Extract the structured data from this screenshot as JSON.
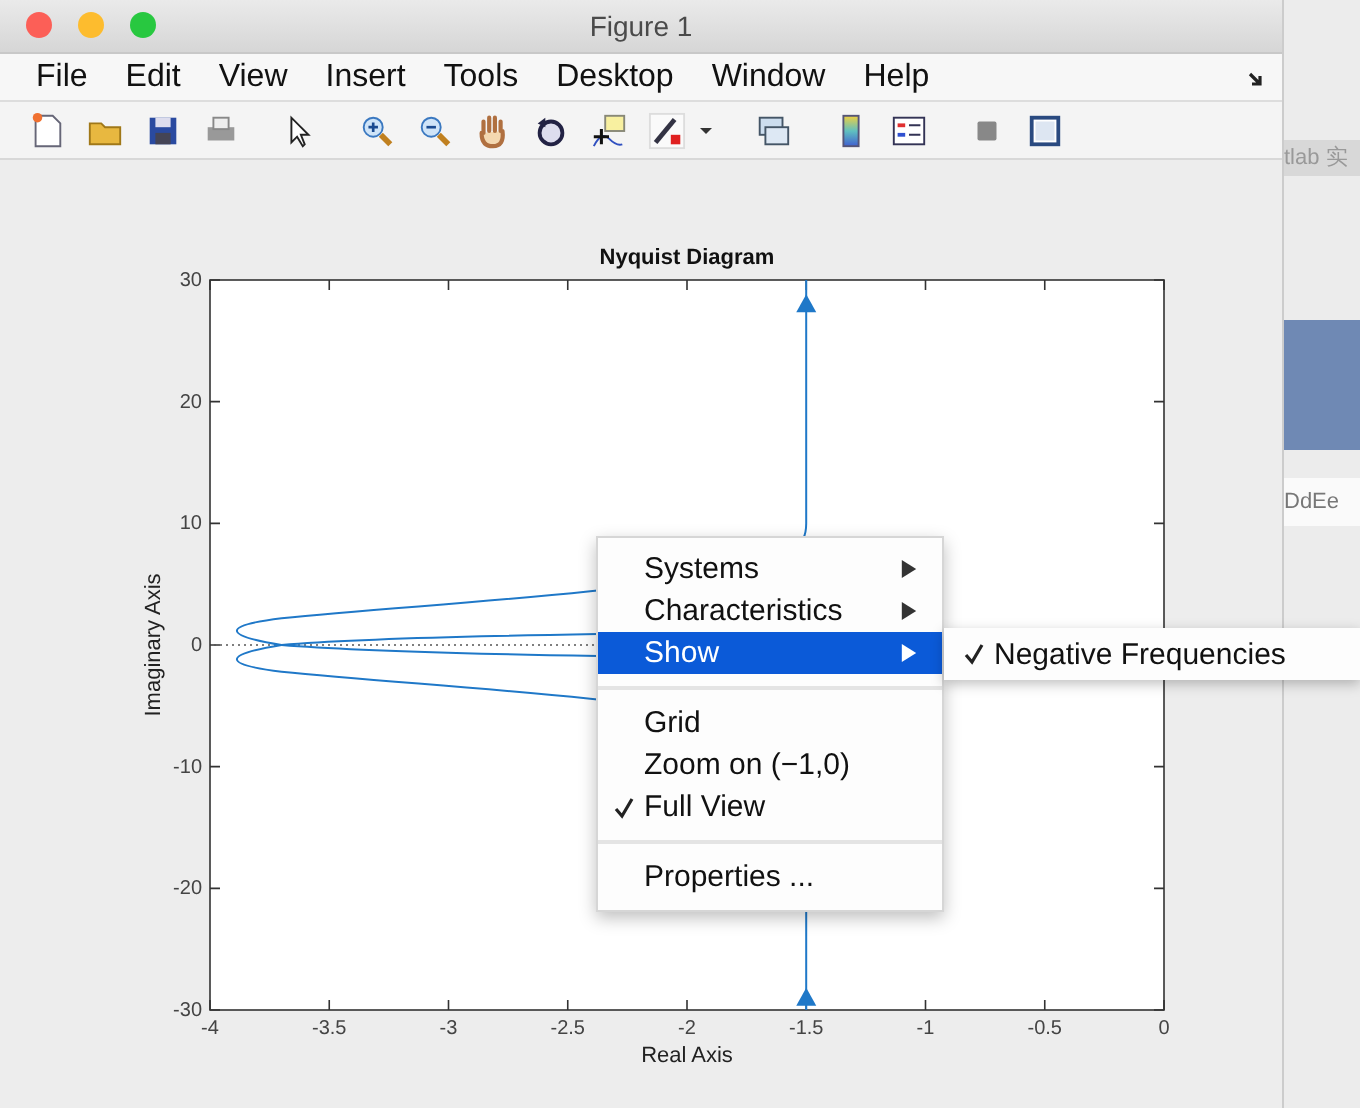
{
  "window": {
    "title": "Figure 1"
  },
  "menu_bar": [
    "File",
    "Edit",
    "View",
    "Insert",
    "Tools",
    "Desktop",
    "Window",
    "Help"
  ],
  "chart": {
    "chart_data": {
      "type": "line",
      "title": "Nyquist Diagram",
      "xlabel": "Real Axis",
      "ylabel": "Imaginary Axis",
      "xlim": [
        -4,
        0
      ],
      "ylim": [
        -30,
        30
      ],
      "xticks": [
        {
          "value": -4,
          "label": "-4"
        },
        {
          "value": -3.5,
          "label": "-3.5"
        },
        {
          "value": -3,
          "label": "-3"
        },
        {
          "value": -2.5,
          "label": "-2.5"
        },
        {
          "value": -2,
          "label": "-2"
        },
        {
          "value": -1.5,
          "label": "-1.5"
        },
        {
          "value": -1,
          "label": "-1"
        },
        {
          "value": -0.5,
          "label": "-0.5"
        },
        {
          "value": 0,
          "label": "0"
        }
      ],
      "yticks": [
        {
          "value": 30,
          "label": "30"
        },
        {
          "value": 20,
          "label": "20"
        },
        {
          "value": 10,
          "label": "10"
        },
        {
          "value": 0,
          "label": "0"
        },
        {
          "value": -10,
          "label": "-10"
        },
        {
          "value": -20,
          "label": "-20"
        },
        {
          "value": -30,
          "label": "-30"
        }
      ]
    }
  },
  "context_menu": {
    "groups": [
      [
        {
          "label": "Systems",
          "submenu": true,
          "checked": false,
          "selected": false
        },
        {
          "label": "Characteristics",
          "submenu": true,
          "checked": false,
          "selected": false
        },
        {
          "label": "Show",
          "submenu": true,
          "checked": false,
          "selected": true
        }
      ],
      [
        {
          "label": "Grid",
          "submenu": false,
          "checked": false,
          "selected": false
        },
        {
          "label": "Zoom on (−1,0)",
          "submenu": false,
          "checked": false,
          "selected": false
        },
        {
          "label": "Full View",
          "submenu": false,
          "checked": true,
          "selected": false
        }
      ],
      [
        {
          "label": "Properties ...",
          "submenu": false,
          "checked": false,
          "selected": false
        }
      ]
    ]
  },
  "submenu": {
    "items": [
      {
        "label": "Negative Frequencies",
        "checked": true
      }
    ]
  },
  "background_window": {
    "texts": [
      "tlab 实",
      "DdEe"
    ]
  }
}
